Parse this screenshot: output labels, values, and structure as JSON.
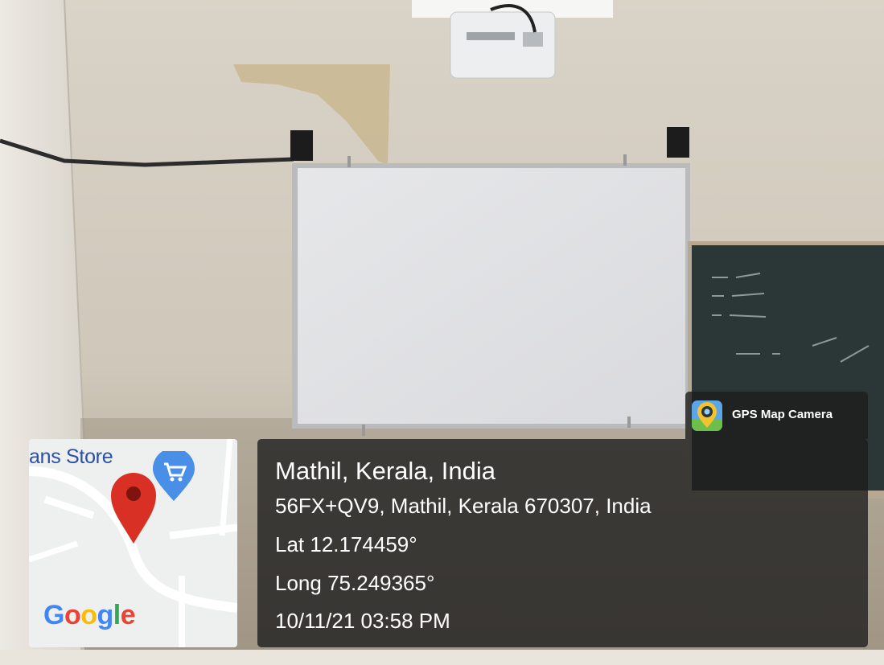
{
  "map": {
    "place_label": "ans Store",
    "logo_letters": [
      "G",
      "o",
      "o",
      "g",
      "l",
      "e"
    ],
    "logo_colors": [
      "#4285F4",
      "#EA4335",
      "#FBBC05",
      "#4285F4",
      "#34A853",
      "#EA4335"
    ],
    "pin_color": "#d93025",
    "store_pin_color": "#4a8fe7",
    "store_icon": "shopping-cart-icon",
    "pin_icon": "map-pin-icon"
  },
  "app_badge": {
    "name": "GPS Map Camera",
    "icon": "gps-map-camera-icon"
  },
  "location": {
    "title": "Mathil, Kerala, India",
    "address": "56FX+QV9, Mathil, Kerala 670307, India",
    "lat": "Lat 12.174459°",
    "long": "Long 75.249365°",
    "datetime": "10/11/21 03:58 PM"
  }
}
